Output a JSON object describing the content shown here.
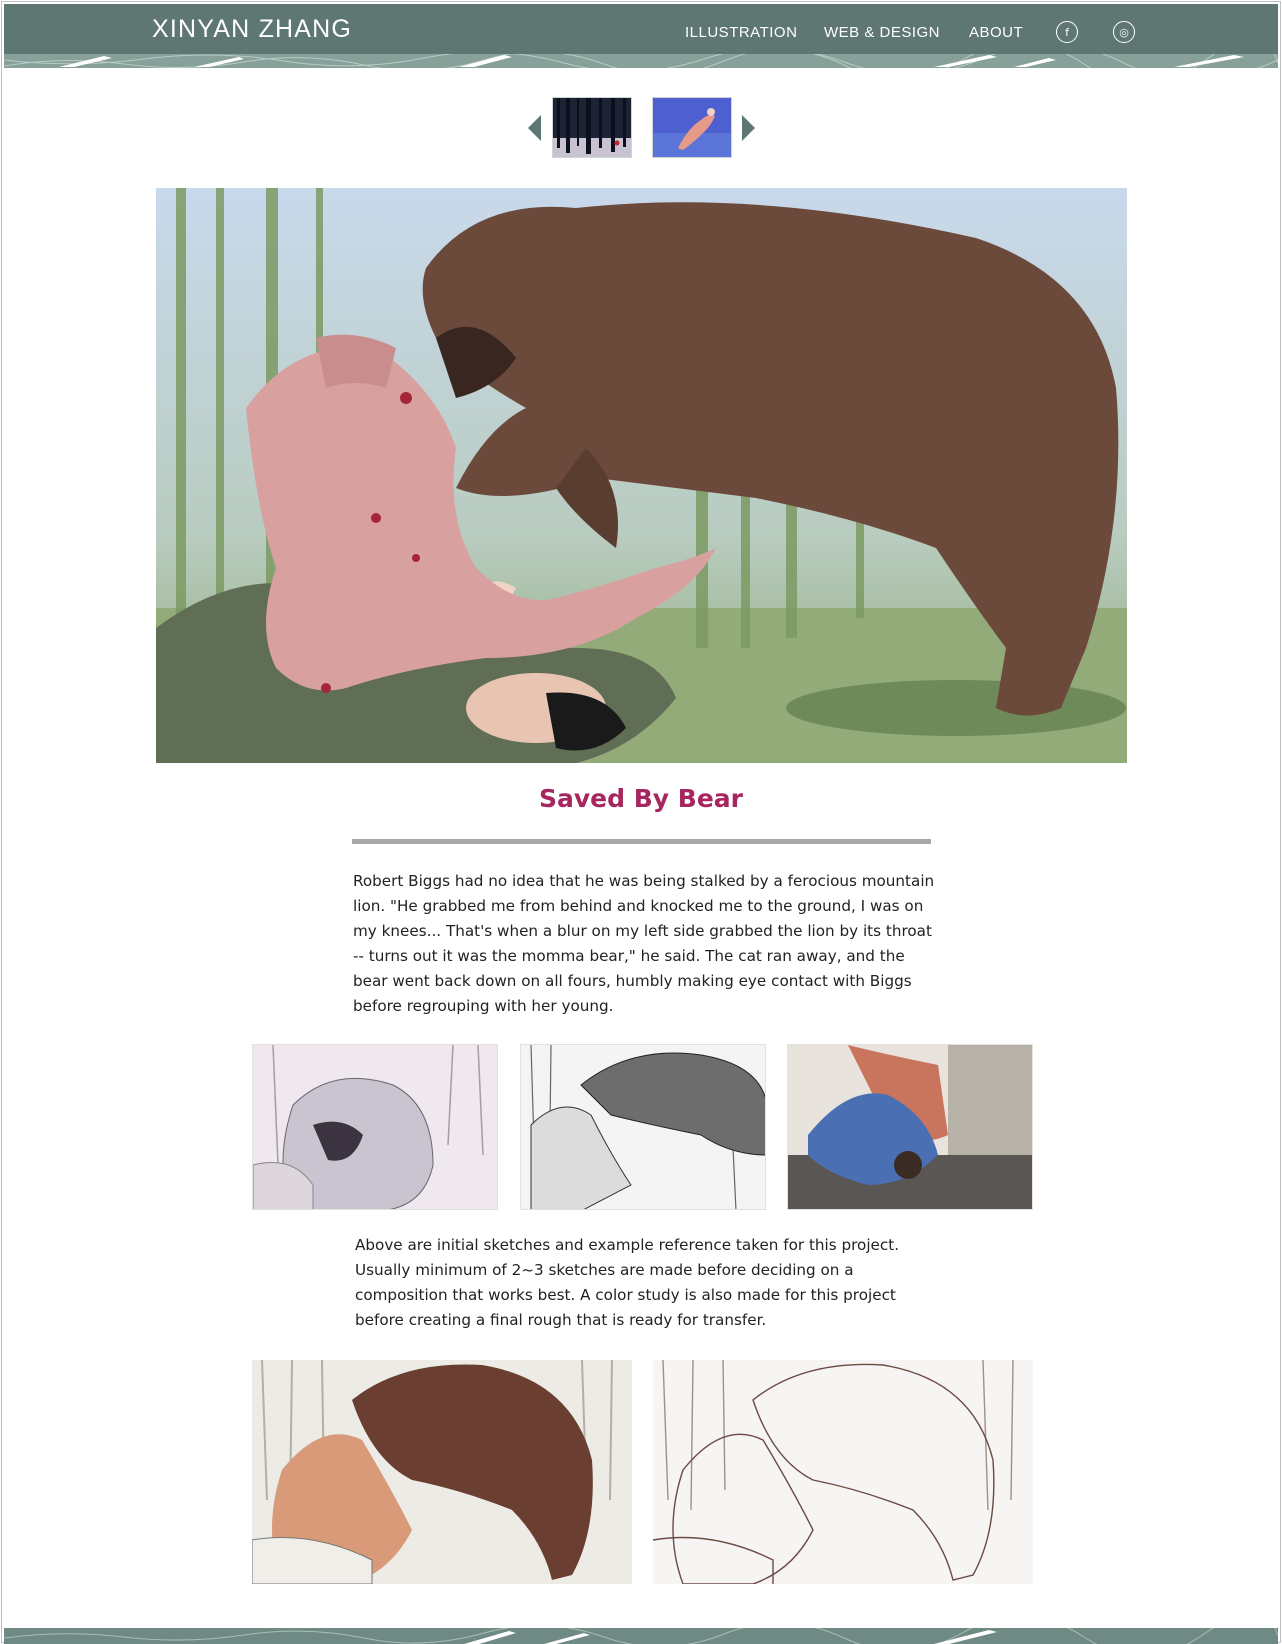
{
  "header": {
    "logo": "XINYAN ZHANG",
    "nav": [
      "ILLUSTRATION",
      "WEB & DESIGN",
      "ABOUT"
    ],
    "social": [
      {
        "icon": "facebook-icon",
        "glyph": "f"
      },
      {
        "icon": "instagram-icon",
        "glyph": "◎"
      }
    ],
    "color": "#5e7772"
  },
  "gallery_nav": {
    "prev_icon": "triangle-left-icon",
    "next_icon": "triangle-right-icon",
    "thumbnails": [
      "forest-thumbnail",
      "underwater-thumbnail"
    ]
  },
  "artwork": {
    "title": "Saved By Bear",
    "title_color": "#a6265f",
    "description": "Robert Biggs had no idea that he was being stalked by a ferocious mountain lion. \"He grabbed me from behind and knocked me to the ground, I was on my knees... That's when a blur on my left side grabbed the lion by its throat -- turns out it was the momma bear,\" he said. The cat ran away, and the bear went back down on all fours, humbly making eye contact with Biggs before regrouping with her young.",
    "process_text": "Above are initial sketches and example reference taken for this project. Usually minimum of 2~3 sketches are made before deciding on a composition that works best. A color study is also made for this project before creating a final rough that is ready for transfer."
  }
}
